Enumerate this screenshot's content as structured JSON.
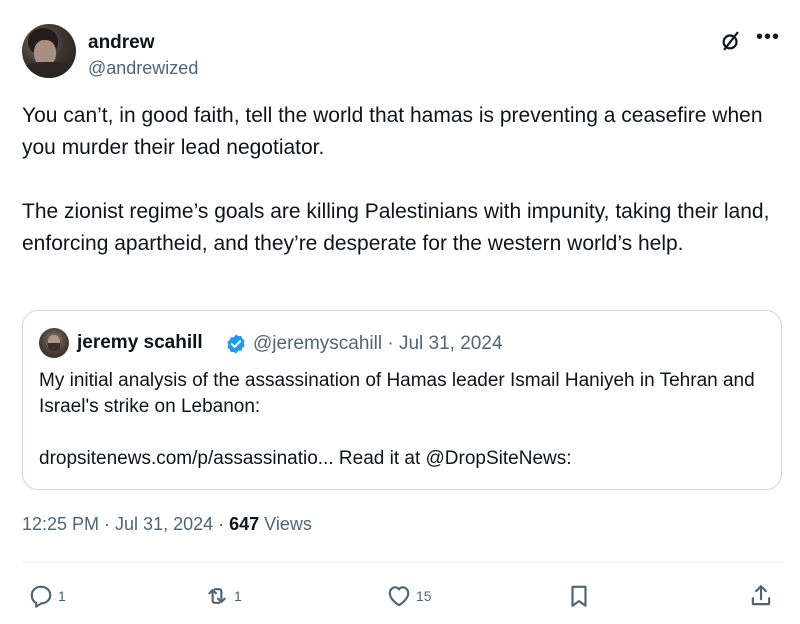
{
  "author": {
    "name": "andrew",
    "handle": "@andrewized"
  },
  "tweet": {
    "paragraphs": [
      "You can’t, in good faith, tell the world that  hamas is preventing a ceasefire when you murder their lead negotiator.",
      "The zionist regime’s goals are killing Palestinians with impunity, taking their land, enforcing apartheid, and they’re desperate for the western world’s help."
    ]
  },
  "quote": {
    "name": "jeremy scahill",
    "handle_date": "@jeremyscahill · Jul 31, 2024",
    "text_line1": "My initial analysis of the assassination of Hamas leader Ismail Haniyeh in Tehran and Israel's strike on Lebanon:",
    "text_line2": "dropsitenews.com/p/assassinatio... Read it at @DropSiteNews:"
  },
  "meta": {
    "time_date": "12:25 PM · Jul 31, 2024 · ",
    "views_count": "647",
    "views_label": " Views"
  },
  "actions": {
    "reply_count": "1",
    "repost_count": "1",
    "like_count": "15"
  },
  "colors": {
    "text": "#0f1419",
    "secondary": "#536471",
    "border": "#cfd9de",
    "verified": "#1d9bf0"
  },
  "icons": [
    "grok-icon",
    "more-icon",
    "verified-icon",
    "reply-icon",
    "repost-icon",
    "like-icon",
    "bookmark-icon",
    "share-icon"
  ]
}
